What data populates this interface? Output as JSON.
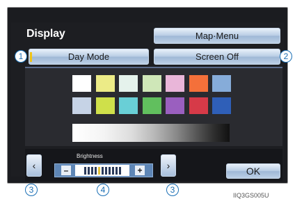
{
  "title": "Display",
  "buttons": {
    "map_menu": "Map·Menu",
    "day_mode": "Day Mode",
    "screen_off": "Screen Off",
    "ok": "OK"
  },
  "brightness": {
    "label": "Brightness",
    "minus": "–",
    "plus": "+",
    "level_index": 4,
    "steps": 11
  },
  "arrows": {
    "left": "‹",
    "right": "›"
  },
  "callouts": [
    "1",
    "2",
    "3",
    "4",
    "3"
  ],
  "image_code": "IIQ3GS005U",
  "swatches_row1": [
    "#ffffff",
    "#eceb87",
    "#e5f2ec",
    "#cfe7b8",
    "#e9b6d9",
    "#f4703a",
    "#86acd9"
  ],
  "swatches_row2": [
    "#c6d3e6",
    "#cfe04a",
    "#69cfd6",
    "#61bf5e",
    "#9a5fbf",
    "#d63a48",
    "#2f5fb8"
  ]
}
